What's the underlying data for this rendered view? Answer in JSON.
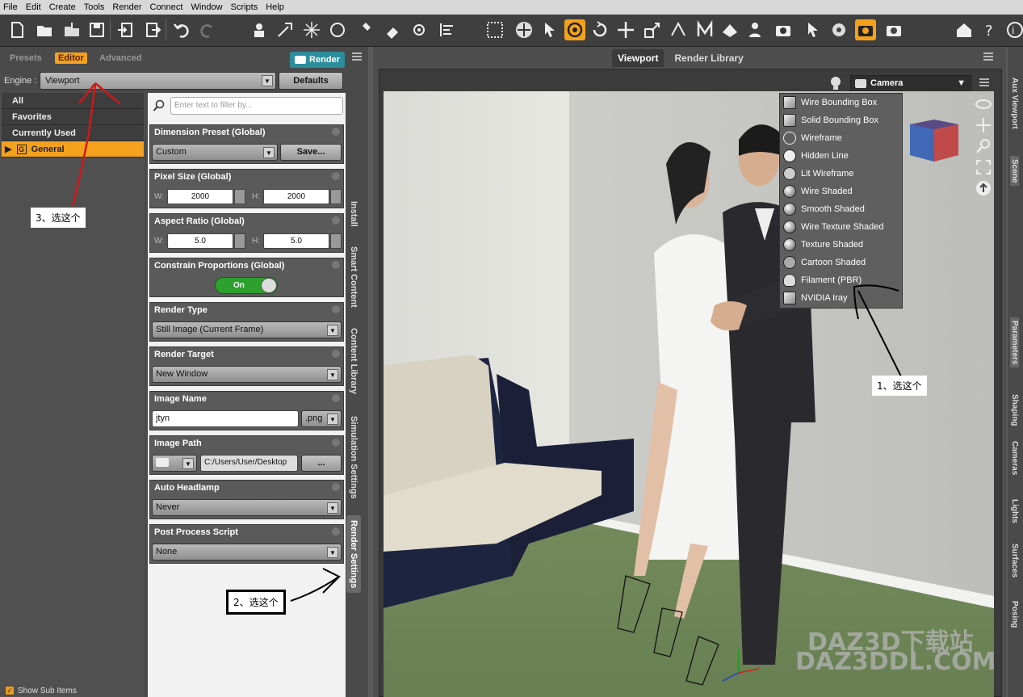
{
  "menu": [
    "File",
    "Edit",
    "Create",
    "Tools",
    "Render",
    "Connect",
    "Window",
    "Scripts",
    "Help"
  ],
  "pane_tabs": {
    "presets": "Presets",
    "editor": "Editor",
    "advanced": "Advanced",
    "render_button": "Render"
  },
  "engine": {
    "label": "Engine :",
    "value": "Viewport",
    "defaults_button": "Defaults"
  },
  "filter_placeholder": "Enter text to filter by...",
  "categories": [
    "All",
    "Favorites",
    "Currently Used",
    "General"
  ],
  "show_sub_items": "Show Sub Items",
  "settings": {
    "dimension_preset": {
      "title": "Dimension Preset (Global)",
      "value": "Custom",
      "button": "Save..."
    },
    "pixel_size": {
      "title": "Pixel Size (Global)",
      "w_label": "W:",
      "w": "2000",
      "h_label": "H:",
      "h": "2000"
    },
    "aspect_ratio": {
      "title": "Aspect Ratio (Global)",
      "w_label": "W:",
      "w": "5.0",
      "h_label": "H:",
      "h": "5.0"
    },
    "constrain": {
      "title": "Constrain Proportions (Global)",
      "value": "On"
    },
    "render_type": {
      "title": "Render Type",
      "value": "Still Image (Current Frame)"
    },
    "render_target": {
      "title": "Render Target",
      "value": "New Window"
    },
    "image_name": {
      "title": "Image Name",
      "value": "jtyn",
      "ext": ".png"
    },
    "image_path": {
      "title": "Image Path",
      "value": "C:/Users/User/Desktop",
      "button": "..."
    },
    "auto_headlamp": {
      "title": "Auto Headlamp",
      "value": "Never"
    },
    "post_process": {
      "title": "Post Process Script",
      "value": "None"
    }
  },
  "side_tabs": [
    "Install",
    "Smart Content",
    "Content Library",
    "Simulation Settings",
    "Render Settings"
  ],
  "viewport_tabs": {
    "viewport": "Viewport",
    "render_library": "Render Library"
  },
  "camera": "Camera",
  "dropdown_items": [
    "Wire Bounding Box",
    "Solid Bounding Box",
    "Wireframe",
    "Hidden Line",
    "Lit Wireframe",
    "Wire Shaded",
    "Smooth Shaded",
    "Wire Texture Shaded",
    "Texture Shaded",
    "Cartoon Shaded",
    "Filament (PBR)",
    "NVIDIA Iray"
  ],
  "right_tabs": [
    "Aux Viewport",
    "Scene",
    "Parameters",
    "Shaping",
    "Cameras",
    "Lights",
    "Surfaces",
    "Posing"
  ],
  "annotations": {
    "one": "1、选这个",
    "two": "2、选这个",
    "three": "3、选这个"
  },
  "watermark": {
    "line1": "DAZ3D下载站",
    "line2": "DAZ3DDL.COM"
  },
  "colors": {
    "accent": "#f4a21d",
    "render": "#2d8d9d",
    "toggle_on": "#2ea02e"
  }
}
